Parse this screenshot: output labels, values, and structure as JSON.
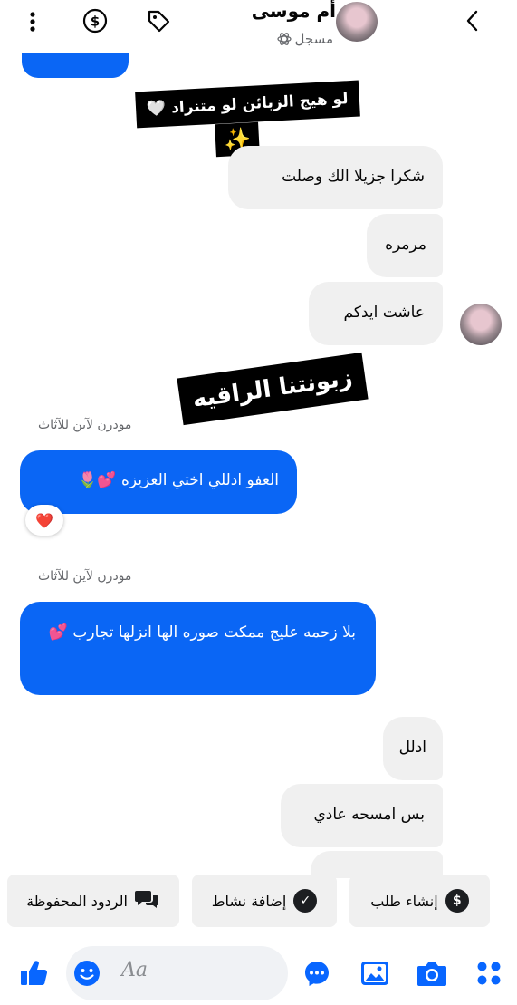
{
  "header": {
    "contact_name": "أم موسى",
    "contact_status": "مسجل",
    "icons": [
      "more-vert-icon",
      "dollar-circle-icon",
      "tag-icon",
      "back-chevron-icon"
    ]
  },
  "stickers": {
    "top_text": "لو هيج الزبائن لو متنراد 🤍",
    "top_emoji": "✨",
    "middle_text": "زبونتنا الراقيه"
  },
  "messages": {
    "incoming": [
      "شكرا جزيلا الك وصلت",
      "مرمره",
      "عاشت ايدكم"
    ],
    "sender_label_1": "مودرن لآين للآثاث",
    "outgoing_1": "العفو ادللي اختي العزيزه 💕🌷",
    "reaction_1": "❤️",
    "sender_label_2": "مودرن لآين للآثاث",
    "outgoing_2": "بلا زحمه عليج ممكت صوره الها انزلها تجارب 💕",
    "incoming_2": [
      "ادلل",
      "بس امسحه عادي"
    ]
  },
  "quick_actions": [
    {
      "label": "إنشاء طلب",
      "icon": "dollar-icon"
    },
    {
      "label": "إضافة نشاط",
      "icon": "check-icon"
    },
    {
      "label": "الردود المحفوظة",
      "icon": "saved-replies-icon"
    }
  ],
  "composer": {
    "placeholder": "Aa"
  },
  "colors": {
    "accent": "#0866ff",
    "outgoing_bubble": "#0a66f5",
    "incoming_bubble": "#f0f0f0"
  }
}
